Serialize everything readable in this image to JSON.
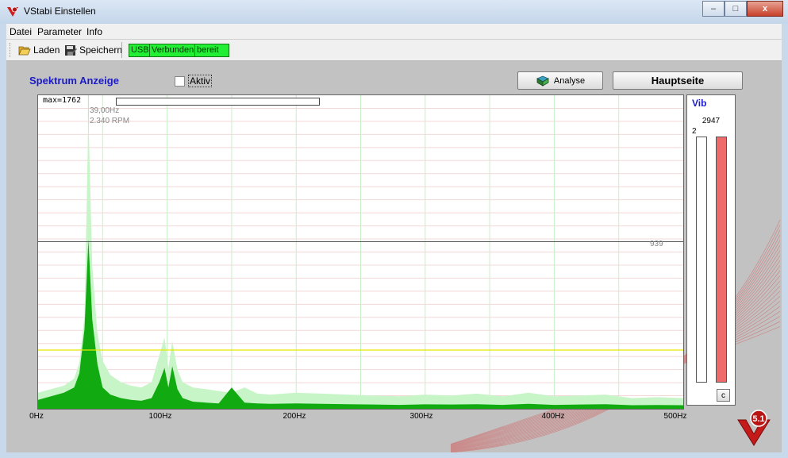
{
  "window": {
    "title": "VStabi Einstellen",
    "controls": {
      "minimize": "–",
      "maximize": "□",
      "close": "x"
    }
  },
  "menu": {
    "items": [
      "Datei",
      "Parameter",
      "Info"
    ]
  },
  "toolbar": {
    "load_label": "Laden",
    "save_label": "Speichern",
    "usb_label": "USB",
    "connected_label": "Verbunden",
    "ready_label": "bereit"
  },
  "spectrum": {
    "title": "Spektrum Anzeige",
    "aktiv_label": "Aktiv",
    "aktiv_checked": false,
    "analyse_label": "Analyse",
    "hauptseite_label": "Hauptseite",
    "max_label": "max=1762",
    "cursor_freq": "39,00Hz",
    "cursor_rpm": "2.340 RPM",
    "threshold_label": "939",
    "x_ticks": [
      "0Hz",
      "100Hz",
      "200Hz",
      "300Hz",
      "400Hz",
      "500Hz"
    ]
  },
  "chart_data": {
    "type": "area",
    "xlabel": "",
    "ylabel": "",
    "xlim": [
      0,
      500
    ],
    "ylim": [
      0,
      1762
    ],
    "reference_lines": [
      939,
      330
    ],
    "series": [
      {
        "name": "",
        "color": "#c8f5c8",
        "x": [
          0,
          10,
          20,
          28,
          32,
          36,
          39,
          42,
          46,
          50,
          56,
          64,
          72,
          80,
          88,
          94,
          98,
          101,
          104,
          108,
          112,
          120,
          130,
          140,
          150,
          160,
          170,
          180,
          200,
          220,
          240,
          260,
          280,
          300,
          320,
          340,
          360,
          380,
          400,
          420,
          440,
          460,
          480,
          500
        ],
        "y": [
          90,
          110,
          130,
          170,
          260,
          520,
          1650,
          800,
          420,
          270,
          190,
          150,
          130,
          120,
          150,
          300,
          400,
          230,
          380,
          220,
          150,
          120,
          110,
          100,
          90,
          120,
          85,
          80,
          90,
          85,
          80,
          75,
          70,
          80,
          75,
          85,
          70,
          90,
          70,
          75,
          80,
          60,
          65,
          60
        ]
      },
      {
        "name": "",
        "color": "#11aa11",
        "x": [
          0,
          10,
          20,
          28,
          32,
          36,
          39,
          42,
          46,
          50,
          56,
          64,
          72,
          80,
          88,
          94,
          98,
          101,
          104,
          108,
          112,
          120,
          130,
          140,
          150,
          160,
          170,
          180,
          200,
          220,
          240,
          260,
          280,
          300,
          320,
          340,
          360,
          380,
          400,
          420,
          440,
          460,
          480,
          500
        ],
        "y": [
          50,
          70,
          90,
          120,
          200,
          450,
          950,
          500,
          250,
          120,
          80,
          60,
          50,
          45,
          60,
          150,
          230,
          120,
          240,
          110,
          60,
          40,
          35,
          30,
          120,
          35,
          30,
          28,
          30,
          28,
          26,
          24,
          22,
          25,
          24,
          26,
          22,
          28,
          22,
          24,
          26,
          20,
          21,
          20
        ]
      }
    ]
  },
  "vib": {
    "title": "Vib",
    "value": "2947",
    "small_value": "2",
    "clear_label": "c",
    "level_left": 0,
    "level_right": 1
  }
}
